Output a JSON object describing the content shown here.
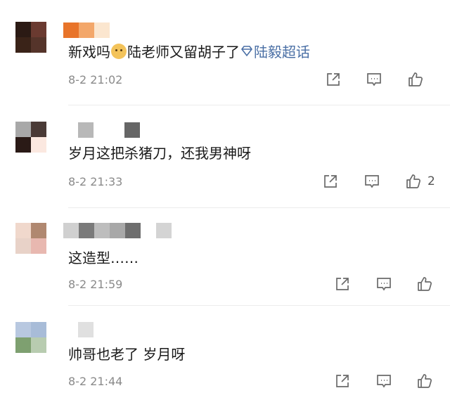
{
  "comments": [
    {
      "text": "新戏吗",
      "text_after": "陆老师又留胡子了",
      "topic": "陆毅超话",
      "time": "8-2 21:02",
      "likes": ""
    },
    {
      "text": "岁月这把杀猪刀，还我男神呀",
      "time": "8-2 21:33",
      "likes": "2"
    },
    {
      "text": "这造型……",
      "time": "8-2 21:59",
      "likes": ""
    },
    {
      "text": "帅哥也老了 岁月呀",
      "time": "8-2 21:44",
      "likes": ""
    }
  ],
  "icons": {
    "share": "share-icon",
    "comment": "comment-icon",
    "like": "thumbs-up-icon",
    "emoji": "doge-emoji-icon",
    "topic": "diamond-topic-icon"
  },
  "colors": {
    "text": "#1a1a1a",
    "time": "#8a8a8a",
    "topic": "#4a6fa5",
    "icon": "#6a6a6a"
  }
}
